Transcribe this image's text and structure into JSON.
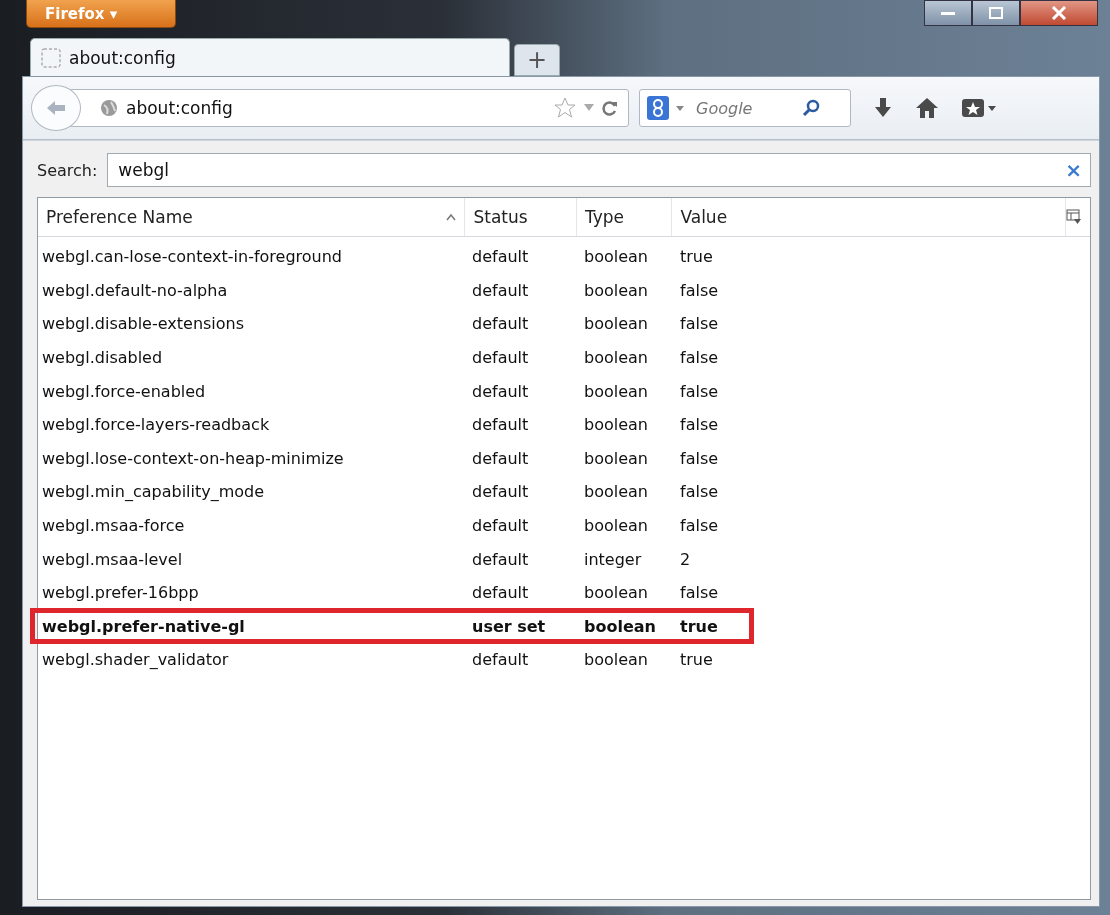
{
  "app_button": {
    "label": "Firefox",
    "caret": "▾"
  },
  "tabs": [
    {
      "title": "about:config",
      "selected": true
    }
  ],
  "new_tab": "+",
  "url_bar": {
    "value": "about:config"
  },
  "search_engine": {
    "placeholder": "Google"
  },
  "config_search": {
    "label": "Search:",
    "value": "webgl",
    "clear": "×"
  },
  "table": {
    "columns": [
      {
        "label": "Preference Name",
        "sorted": true
      },
      {
        "label": "Status",
        "sorted": false
      },
      {
        "label": "Type",
        "sorted": false
      },
      {
        "label": "Value",
        "sorted": false
      }
    ],
    "rows": [
      {
        "name": "webgl.can-lose-context-in-foreground",
        "status": "default",
        "type": "boolean",
        "value": "true",
        "modified": false,
        "highlighted": false
      },
      {
        "name": "webgl.default-no-alpha",
        "status": "default",
        "type": "boolean",
        "value": "false",
        "modified": false,
        "highlighted": false
      },
      {
        "name": "webgl.disable-extensions",
        "status": "default",
        "type": "boolean",
        "value": "false",
        "modified": false,
        "highlighted": false
      },
      {
        "name": "webgl.disabled",
        "status": "default",
        "type": "boolean",
        "value": "false",
        "modified": false,
        "highlighted": false
      },
      {
        "name": "webgl.force-enabled",
        "status": "default",
        "type": "boolean",
        "value": "false",
        "modified": false,
        "highlighted": false
      },
      {
        "name": "webgl.force-layers-readback",
        "status": "default",
        "type": "boolean",
        "value": "false",
        "modified": false,
        "highlighted": false
      },
      {
        "name": "webgl.lose-context-on-heap-minimize",
        "status": "default",
        "type": "boolean",
        "value": "false",
        "modified": false,
        "highlighted": false
      },
      {
        "name": "webgl.min_capability_mode",
        "status": "default",
        "type": "boolean",
        "value": "false",
        "modified": false,
        "highlighted": false
      },
      {
        "name": "webgl.msaa-force",
        "status": "default",
        "type": "boolean",
        "value": "false",
        "modified": false,
        "highlighted": false
      },
      {
        "name": "webgl.msaa-level",
        "status": "default",
        "type": "integer",
        "value": "2",
        "modified": false,
        "highlighted": false
      },
      {
        "name": "webgl.prefer-16bpp",
        "status": "default",
        "type": "boolean",
        "value": "false",
        "modified": false,
        "highlighted": false
      },
      {
        "name": "webgl.prefer-native-gl",
        "status": "user set",
        "type": "boolean",
        "value": "true",
        "modified": true,
        "highlighted": true
      },
      {
        "name": "webgl.shader_validator",
        "status": "default",
        "type": "boolean",
        "value": "true",
        "modified": false,
        "highlighted": false
      }
    ]
  }
}
